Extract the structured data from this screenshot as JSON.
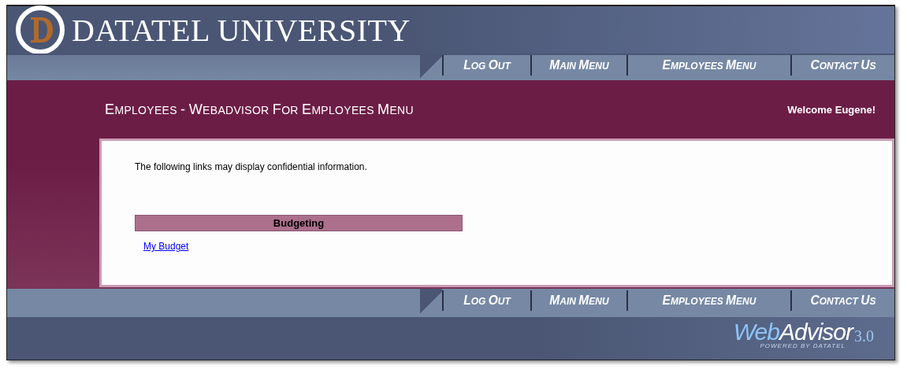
{
  "header": {
    "title": "DATATEL UNIVERSITY"
  },
  "nav": [
    "LOG OUT",
    "MAIN MENU",
    "EMPLOYEES MENU",
    "CONTACT US"
  ],
  "page_title": "EMPLOYEES - WEBADVISOR FOR EMPLOYEES MENU",
  "welcome": "Welcome Eugene!",
  "notice": "The following links may display confidential information.",
  "sections": [
    {
      "heading": "Budgeting",
      "links": [
        "My Budget"
      ]
    }
  ],
  "footer_nav": [
    "LOG OUT",
    "MAIN MENU",
    "EMPLOYEES MENU",
    "CONTACT US"
  ],
  "footer_logo": {
    "brand_a": "Web",
    "brand_b": "Advisor",
    "version": "3.0",
    "tagline": "POWERED BY DATATEL"
  }
}
